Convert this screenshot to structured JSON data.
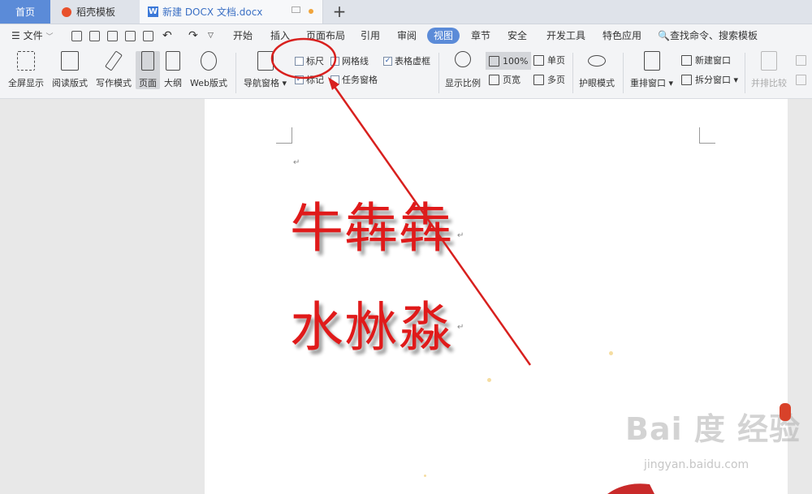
{
  "tabs": {
    "home": "首页",
    "templates": "稻壳模板",
    "document": "新建 DOCX 文档.docx",
    "doc_icon": "W",
    "new_tab": "+"
  },
  "menu": {
    "file": "文件",
    "items": [
      "开始",
      "插入",
      "页面布局",
      "引用",
      "审阅",
      "视图",
      "章节",
      "安全",
      "开发工具",
      "特色应用"
    ],
    "active": "视图",
    "search": "查找命令、搜索模板"
  },
  "ribbon": {
    "fullscreen": "全屏显示",
    "read_mode": "阅读版式",
    "write_mode": "写作模式",
    "page": "页面",
    "outline": "大纲",
    "web_layout": "Web版式",
    "nav_pane": "导航窗格",
    "ruler": "标尺",
    "gridlines": "网格线",
    "table_gridlines": "表格虚框",
    "marks": "标记",
    "task_pane": "任务窗格",
    "zoom": "显示比例",
    "zoom_value": "100%",
    "page_width": "页宽",
    "single_page": "单页",
    "multi_page": "多页",
    "eye_mode": "护眼模式",
    "arrange": "重排窗口",
    "new_window": "新建窗口",
    "split_window": "拆分窗口",
    "side_by_side": "并排比较"
  },
  "checks": {
    "ruler": false,
    "gridlines": false,
    "table_gridlines": true,
    "marks": true,
    "task_pane": false
  },
  "document": {
    "line1": "牛犇犇",
    "line2": "水沝淼"
  },
  "watermark": {
    "logo": "Bai 度 经验",
    "url": "jingyan.baidu.com"
  },
  "colors": {
    "accent": "#5b8bd8",
    "text_red": "#e01a1a",
    "annotation": "#d8201e"
  }
}
